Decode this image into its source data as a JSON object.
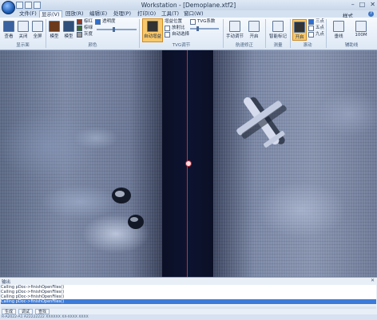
{
  "window": {
    "title": "Workstation - [Demoplane.xtf2]",
    "controls": [
      "–",
      "□",
      "✕"
    ]
  },
  "tabs": [
    {
      "label": "文件(F)",
      "active": false
    },
    {
      "label": "显示(V)",
      "active": true
    },
    {
      "label": "回放(R)",
      "active": false
    },
    {
      "label": "编辑(E)",
      "active": false
    },
    {
      "label": "处理(P)",
      "active": false
    },
    {
      "label": "打印(O)",
      "active": false
    },
    {
      "label": "工具(T)",
      "active": false
    },
    {
      "label": "窗口(W)",
      "active": false
    }
  ],
  "style_label": "样式",
  "ribbon": {
    "groups": [
      {
        "label": "显示面",
        "buttons": [
          "查看",
          "关闭",
          "全屏"
        ]
      },
      {
        "label": "颜色",
        "buttons": [
          "模型",
          "模型"
        ],
        "colors": [
          {
            "name": "棕红",
            "hex": "#8b3a2a"
          },
          {
            "name": "棕绿",
            "hex": "#3d6a2e"
          },
          {
            "name": "灰度",
            "hex": "#9a9a9a"
          }
        ],
        "transparency_label": "透明度"
      },
      {
        "label": "TVG调节",
        "buttons": [
          "自动增益"
        ],
        "options": [
          "增益位置",
          "放射比",
          "自动选择"
        ],
        "tvg_label": "TVG系数"
      },
      {
        "label": "航速修正",
        "buttons": [
          "手动调节",
          "开启"
        ]
      },
      {
        "label": "测量",
        "buttons": [
          "智能标记"
        ]
      },
      {
        "label": "滚动",
        "buttons": [
          "开启"
        ],
        "options": [
          "三点",
          "五点",
          "九点"
        ]
      },
      {
        "label": "辅助线",
        "buttons": [
          "垂线",
          "100M"
        ]
      }
    ]
  },
  "output": {
    "title": "输出",
    "lines": [
      "Calling pDoc->finishOpenFiles()",
      "Calling pDoc->finishOpenFiles()",
      "Calling pDoc->finishOpenFiles()",
      "Calling pDoc->finishOpenFiles()"
    ],
    "selected_index": 3,
    "tabs": [
      "生成",
      "调试",
      "查找"
    ]
  },
  "status_text": "R-A2022-A1 A22222222 XXXXXX XX-XXXX XXXX",
  "colors": {
    "nadir_line": "#d62a2a",
    "water_column": "#0d1330",
    "accent": "#2f6fcf"
  }
}
